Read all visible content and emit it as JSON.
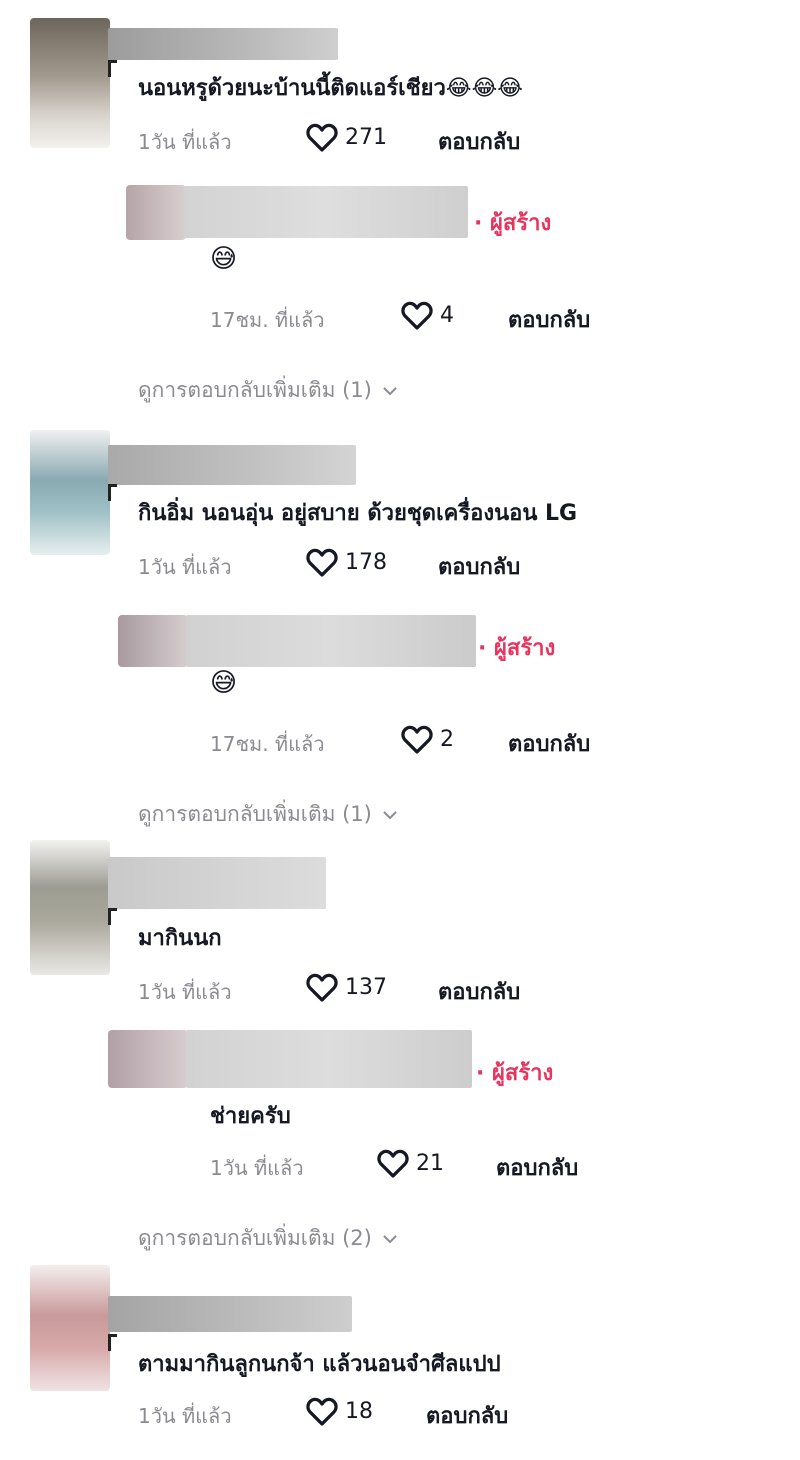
{
  "comments": [
    {
      "text": "นอนหรูด้วยนะบ้านนี้ติดแอร์เชียว😂😂😂",
      "time": "1วัน ที่แล้ว",
      "likes": "271",
      "reply_label": "ตอบกลับ",
      "creator_reply": {
        "tag": "· ผู้สร้าง",
        "text": "😅",
        "time": "17ชม. ที่แล้ว",
        "likes": "4",
        "reply_label": "ตอบกลับ"
      },
      "more_replies": "ดูการตอบกลับเพิ่มเติม (1)"
    },
    {
      "text": "กินอิ่ม นอนอุ่น อยู่สบาย ด้วยชุดเครื่องนอน LG",
      "time": "1วัน ที่แล้ว",
      "likes": "178",
      "reply_label": "ตอบกลับ",
      "creator_reply": {
        "tag": "· ผู้สร้าง",
        "text": "😅",
        "time": "17ชม. ที่แล้ว",
        "likes": "2",
        "reply_label": "ตอบกลับ"
      },
      "more_replies": "ดูการตอบกลับเพิ่มเติม (1)"
    },
    {
      "text": "มากินนก",
      "time": "1วัน ที่แล้ว",
      "likes": "137",
      "reply_label": "ตอบกลับ",
      "creator_reply": {
        "tag": "· ผู้สร้าง",
        "text": "ช่ายครับ",
        "time": "1วัน ที่แล้ว",
        "likes": "21",
        "reply_label": "ตอบกลับ"
      },
      "more_replies": "ดูการตอบกลับเพิ่มเติม (2)"
    },
    {
      "text": "ตามมากินลูกนกจ้า แล้วนอนจำศีลแปป",
      "time": "1วัน ที่แล้ว",
      "likes": "18",
      "reply_label": "ตอบกลับ"
    }
  ],
  "colors": {
    "creator_tag": "#e8335d",
    "meta_text": "#8a8b91",
    "primary_text": "#161823"
  },
  "icons": {
    "like": "heart-outline-icon",
    "expand": "chevron-down-icon"
  }
}
